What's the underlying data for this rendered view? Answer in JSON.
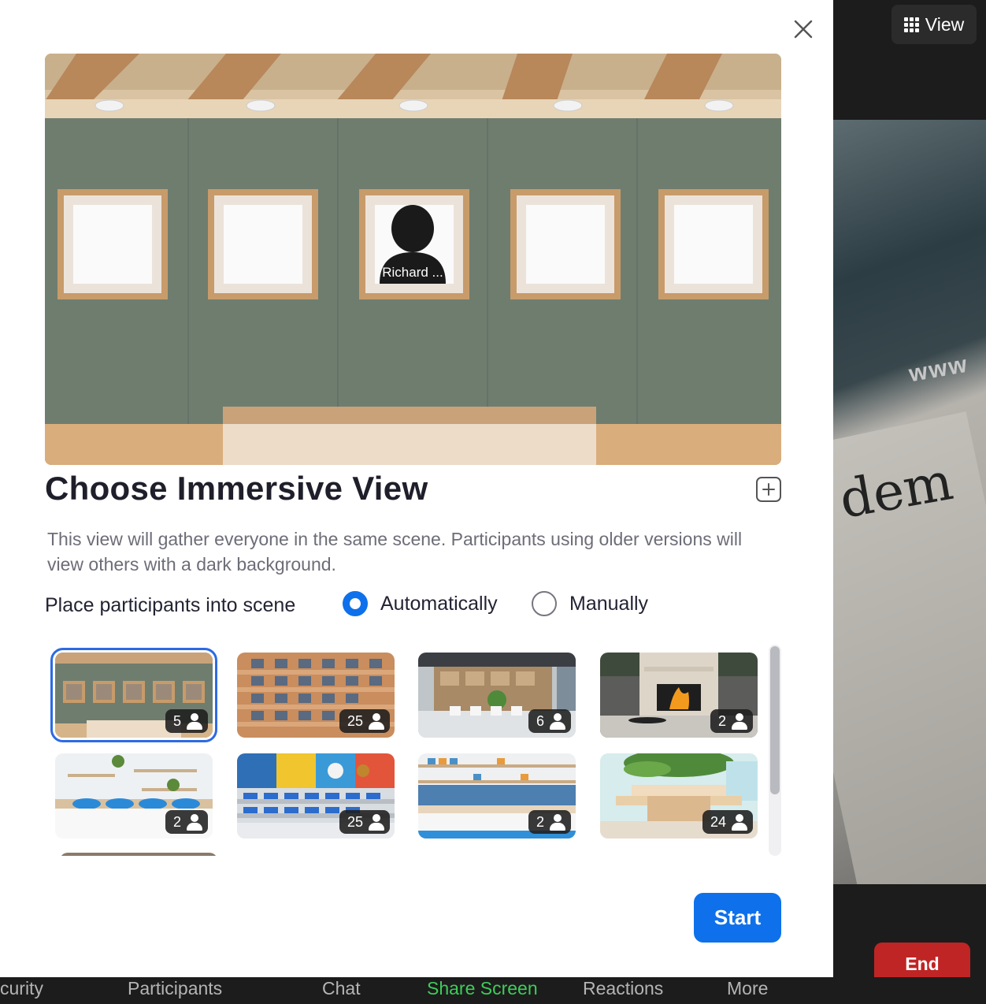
{
  "meeting": {
    "view_label": "View",
    "end_label": "End",
    "video_text_1": "www",
    "video_text_2": "dem"
  },
  "toolbar": {
    "items": [
      {
        "label": "curity"
      },
      {
        "label": "Participants"
      },
      {
        "label": "Chat"
      },
      {
        "label": "Share Screen"
      },
      {
        "label": "Reactions"
      },
      {
        "label": "More"
      }
    ],
    "share_color": "#3fcc5a"
  },
  "dialog": {
    "title": "Choose Immersive View",
    "description": "This view will gather everyone in the same scene. Participants using older versions will view others with a dark background.",
    "preview_participant": "Richard ...",
    "place_label": "Place participants into scene",
    "radio_auto": "Automatically",
    "radio_manual": "Manually",
    "radio_selected": "Automatically",
    "start_label": "Start",
    "accent_color": "#0e71eb"
  },
  "scenes": [
    {
      "name": "gallery",
      "count": "5",
      "selected": true
    },
    {
      "name": "auditorium",
      "count": "25",
      "selected": false
    },
    {
      "name": "cafeteria",
      "count": "6",
      "selected": false
    },
    {
      "name": "fireplace",
      "count": "2",
      "selected": false
    },
    {
      "name": "office",
      "count": "2",
      "selected": false
    },
    {
      "name": "classroom",
      "count": "25",
      "selected": false
    },
    {
      "name": "kitchen",
      "count": "2",
      "selected": false
    },
    {
      "name": "treehouse",
      "count": "24",
      "selected": false
    }
  ]
}
